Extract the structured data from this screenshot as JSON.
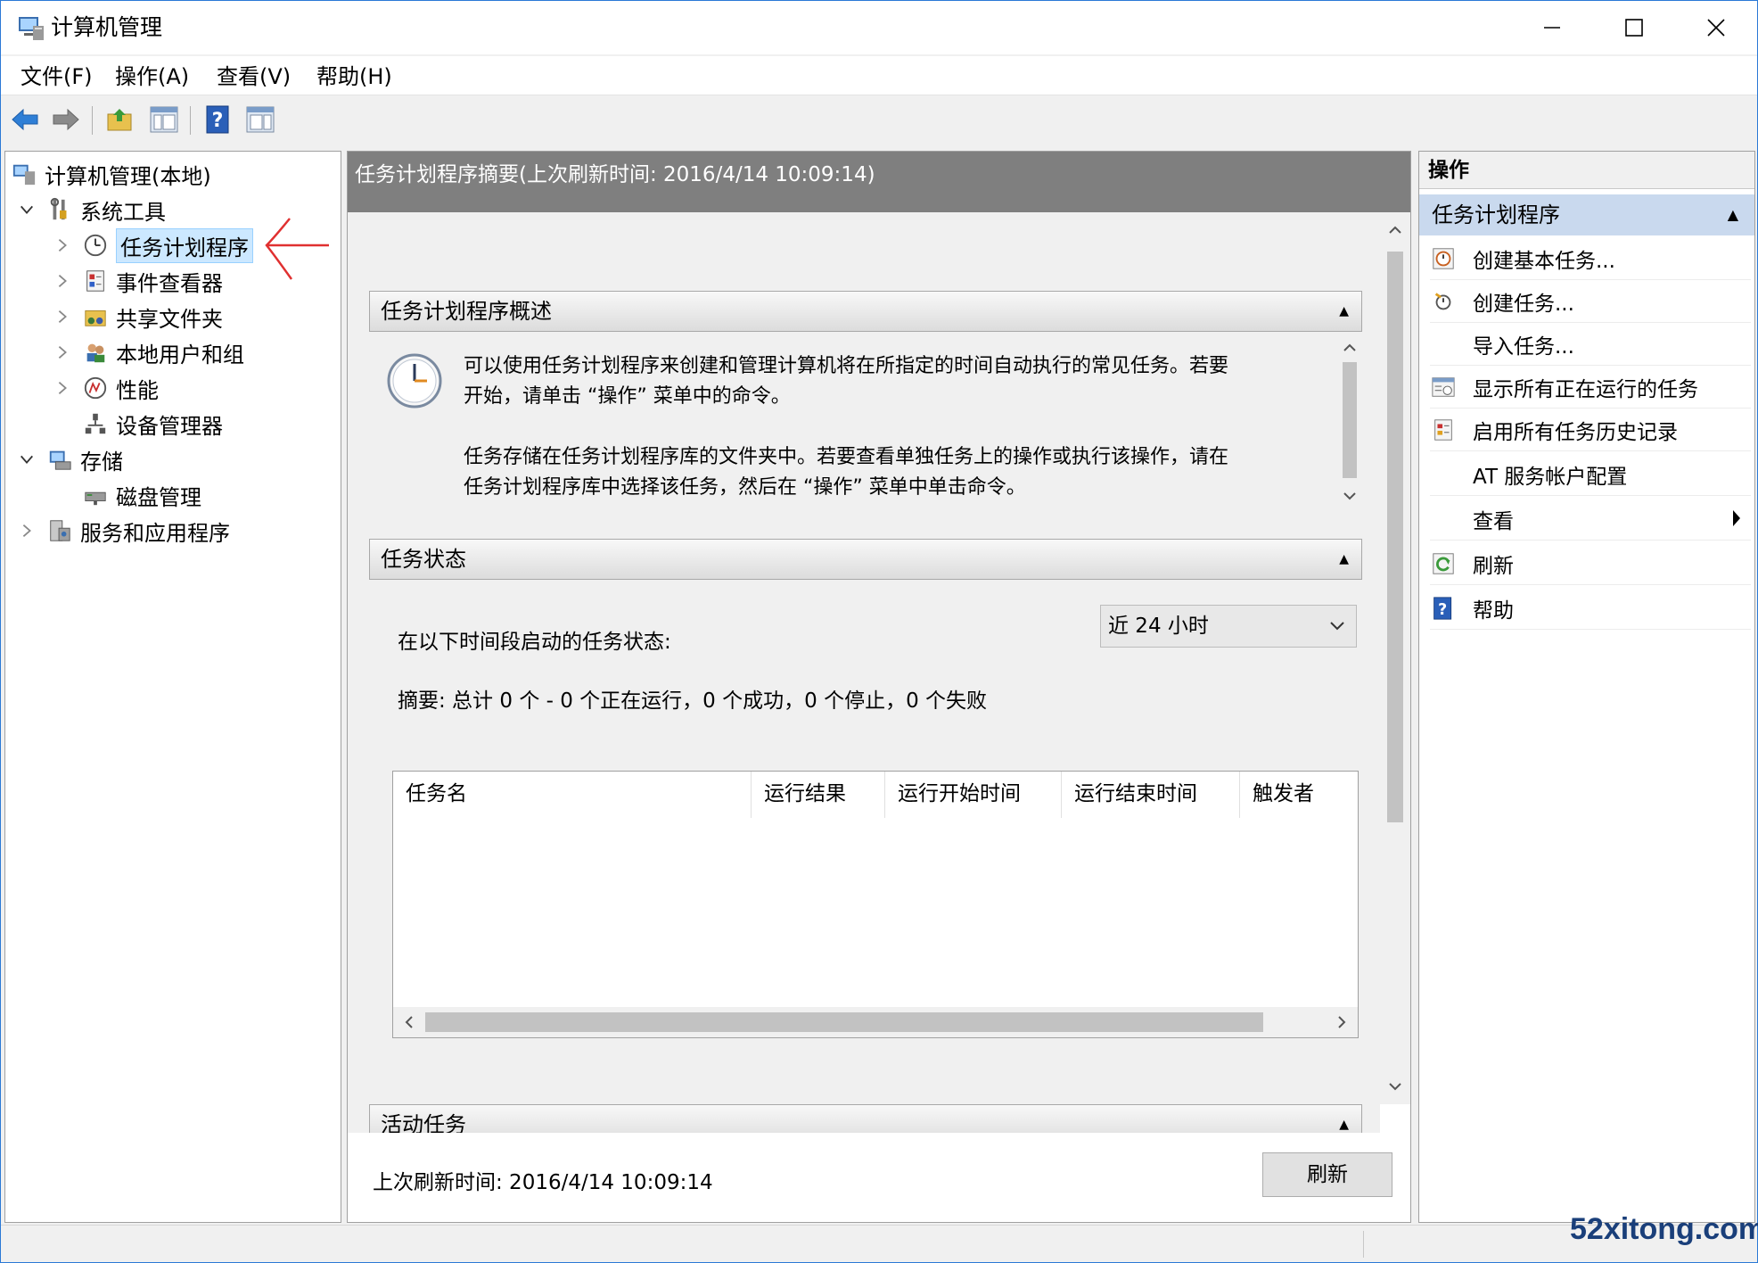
{
  "window": {
    "title": "计算机管理",
    "controls": {
      "minimize": "minimize-icon",
      "maximize": "maximize-icon",
      "close": "close-icon"
    }
  },
  "menu": [
    {
      "label": "文件(F)"
    },
    {
      "label": "操作(A)"
    },
    {
      "label": "查看(V)"
    },
    {
      "label": "帮助(H)"
    }
  ],
  "toolbar": [
    "back-icon",
    "forward-icon",
    "up-folder-icon",
    "show-hide-tree-icon",
    "help-icon",
    "show-hide-action-pane-icon"
  ],
  "tree": {
    "root": "计算机管理(本地)",
    "items": [
      {
        "label": "系统工具",
        "expanded": true
      },
      {
        "label": "任务计划程序",
        "selected": true
      },
      {
        "label": "事件查看器"
      },
      {
        "label": "共享文件夹"
      },
      {
        "label": "本地用户和组"
      },
      {
        "label": "性能"
      },
      {
        "label": "设备管理器"
      },
      {
        "label": "存储",
        "expanded": true
      },
      {
        "label": "磁盘管理"
      },
      {
        "label": "服务和应用程序"
      }
    ]
  },
  "main": {
    "header": "任务计划程序摘要(上次刷新时间: 2016/4/14 10:09:14)",
    "overview": {
      "title": "任务计划程序概述",
      "para1_line1": "可以使用任务计划程序来创建和管理计算机将在所指定的时间自动执行的常见任务。若要",
      "para1_line2": "开始，请单击 “操作” 菜单中的命令。",
      "para2_line1": "任务存储在任务计划程序库的文件夹中。若要查看单独任务上的操作或执行该操作，请在",
      "para2_line2": "任务计划程序库中选择该任务，然后在 “操作” 菜单中单击命令。"
    },
    "status": {
      "title": "任务状态",
      "period_label": "在以下时间段启动的任务状态:",
      "period_value": "近 24 小时",
      "summary": "摘要: 总计 0 个 - 0 个正在运行，0 个成功，0 个停止，0 个失败",
      "columns": [
        "任务名",
        "运行结果",
        "运行开始时间",
        "运行结束时间",
        "触发者"
      ]
    },
    "active": {
      "title": "活动任务"
    },
    "footer": {
      "last_refresh": "上次刷新时间: 2016/4/14 10:09:14",
      "refresh_button": "刷新"
    }
  },
  "actions": {
    "title": "操作",
    "group": "任务计划程序",
    "items": [
      {
        "label": "创建基本任务..."
      },
      {
        "label": "创建任务..."
      },
      {
        "label": "导入任务..."
      },
      {
        "label": "显示所有正在运行的任务"
      },
      {
        "label": "启用所有任务历史记录"
      },
      {
        "label": "AT 服务帐户配置"
      },
      {
        "label": "查看"
      },
      {
        "label": "刷新"
      },
      {
        "label": "帮助"
      }
    ]
  },
  "watermark": "52xitong.com"
}
